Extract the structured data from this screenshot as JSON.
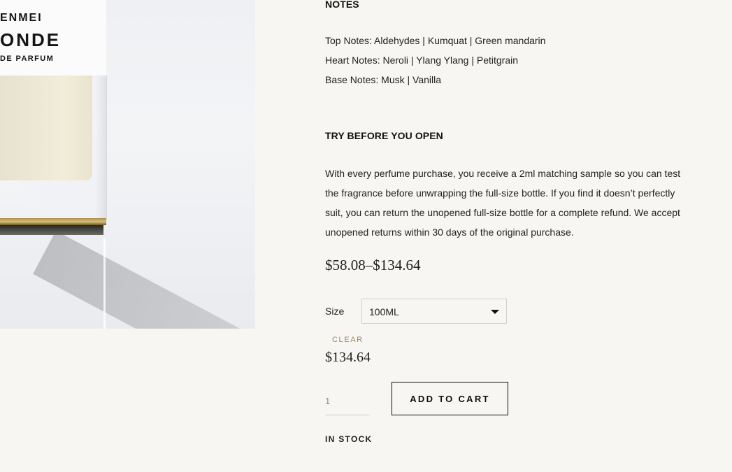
{
  "image": {
    "label_lines": [
      "ENMEI",
      "ONDE",
      "DE PARFUM"
    ]
  },
  "notes": {
    "heading": "NOTES",
    "lines": [
      "Top Notes: Aldehydes | Kumquat | Green mandarin",
      "Heart Notes: Neroli | Ylang Ylang | Petitgrain",
      "Base Notes: Musk | Vanilla"
    ]
  },
  "try_before": {
    "heading": "TRY BEFORE YOU OPEN",
    "description": "With every perfume purchase, you receive a 2ml matching sample so you can test the fragrance before unwrapping the full-size bottle. If you find it doesn’t perfectly suit, you can return the unopened full-size bottle for a complete refund. We accept unopened returns within 30 days of the original purchase."
  },
  "pricing": {
    "range": "$58.08–$134.64",
    "current": "$134.64"
  },
  "size": {
    "label": "Size",
    "selected": "100ML",
    "clear_label": "CLEAR"
  },
  "cart": {
    "quantity": "1",
    "add_label": "ADD TO CART"
  },
  "stock": {
    "status": "IN STOCK"
  },
  "colors": {
    "background": "#f7f6f2",
    "accent_clear": "#a0856a",
    "text": "#222222"
  }
}
